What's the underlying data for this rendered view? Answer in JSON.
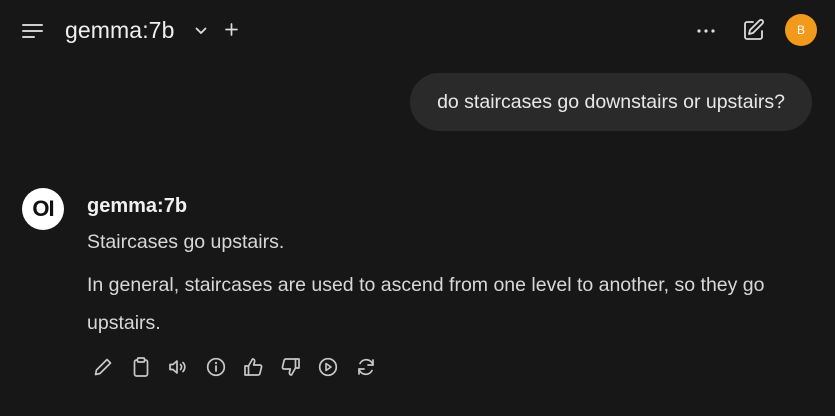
{
  "header": {
    "model_name": "gemma:7b"
  },
  "user": {
    "avatar_initial": "B",
    "avatar_color": "#f29a1c"
  },
  "conversation": {
    "user_message": "do staircases go downstairs or upstairs?",
    "assistant": {
      "logo_text": "OI",
      "name": "gemma:7b",
      "paragraphs": [
        "Staircases go upstairs.",
        "In general, staircases are used to ascend from one level to another, so they go upstairs."
      ]
    }
  },
  "message_actions": [
    "edit-icon",
    "copy-icon",
    "read-aloud-icon",
    "info-icon",
    "thumbs-up-icon",
    "thumbs-down-icon",
    "continue-icon",
    "regenerate-icon"
  ],
  "colors": {
    "background": "#171717",
    "bubble": "#2a2a2a",
    "text": "#d8d8d8"
  }
}
